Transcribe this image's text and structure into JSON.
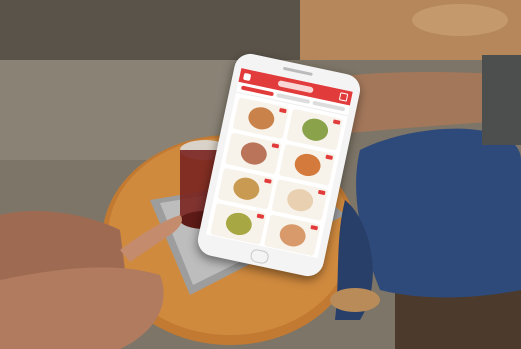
{
  "scene": {
    "description_icon": "photo-scene"
  },
  "phone": {
    "tile_colors": [
      "#c9824a",
      "#8aa34a",
      "#b9745a",
      "#d47a3c",
      "#c99a52",
      "#e8d0b0",
      "#a7a843",
      "#d89a6a"
    ]
  }
}
